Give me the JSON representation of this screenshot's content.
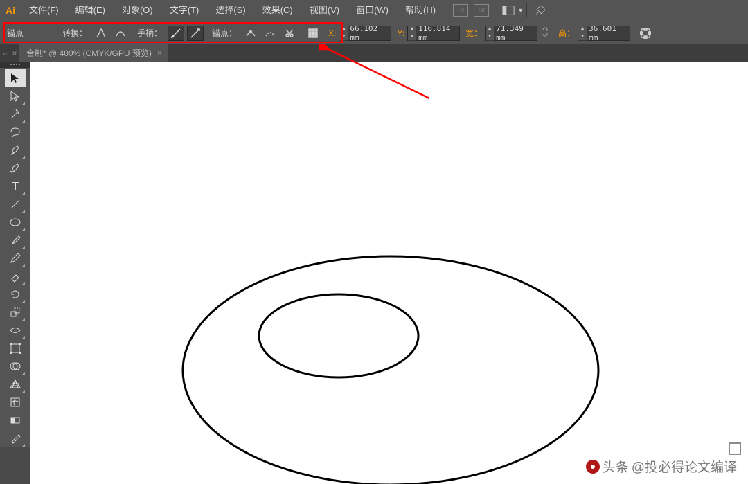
{
  "app": {
    "logo_text": "Ai"
  },
  "menu": {
    "file": "文件(F)",
    "edit": "编辑(E)",
    "object": "对象(O)",
    "type": "文字(T)",
    "select": "选择(S)",
    "effect": "效果(C)",
    "view": "视图(V)",
    "window": "窗口(W)",
    "help": "帮助(H)",
    "box_br": "Br",
    "box_st": "St"
  },
  "options": {
    "anchor_label": "锚点",
    "convert_label": "转换：",
    "handles_label": "手柄：",
    "anchors_label": "锚点：",
    "x_label": "X:",
    "y_label": "Y:",
    "w_label": "宽：",
    "h_label": "高：",
    "x_value": "66.102 mm",
    "y_value": "116.814 mm",
    "w_value": "71.349 mm",
    "h_value": "36.601 mm"
  },
  "tab": {
    "title": "合制* @ 400% (CMYK/GPU 预览)",
    "handle": "››",
    "close": "×"
  },
  "watermark": {
    "prefix": "头条",
    "text": "@投必得论文编译"
  }
}
